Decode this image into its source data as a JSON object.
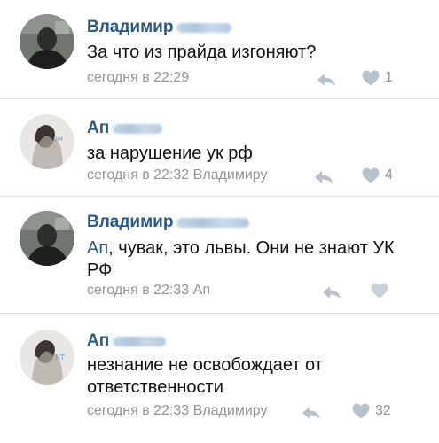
{
  "colors": {
    "link": "#2a5885",
    "text": "#111111",
    "meta": "#939393",
    "icon": "#b8c2cd",
    "divider": "#dcdfe3"
  },
  "comments": [
    {
      "author": "Владимир",
      "text": "За что из прайда изгоняют?",
      "time": "сегодня в 22:29",
      "likes": "1"
    },
    {
      "author": "Ап",
      "text": "за нарушение ук рф",
      "time": "сегодня в 22:32 Владимиру",
      "likes": "4"
    },
    {
      "author": "Владимир",
      "mention": "Ап",
      "text": ", чувак, это львы. Они не знают УК РФ",
      "time": "сегодня в 22:33 Ап",
      "likes": ""
    },
    {
      "author": "Ап",
      "text": "незнание не освобождает от ответственности",
      "time": "сегодня в 22:33 Владимиру",
      "likes": "32"
    }
  ]
}
